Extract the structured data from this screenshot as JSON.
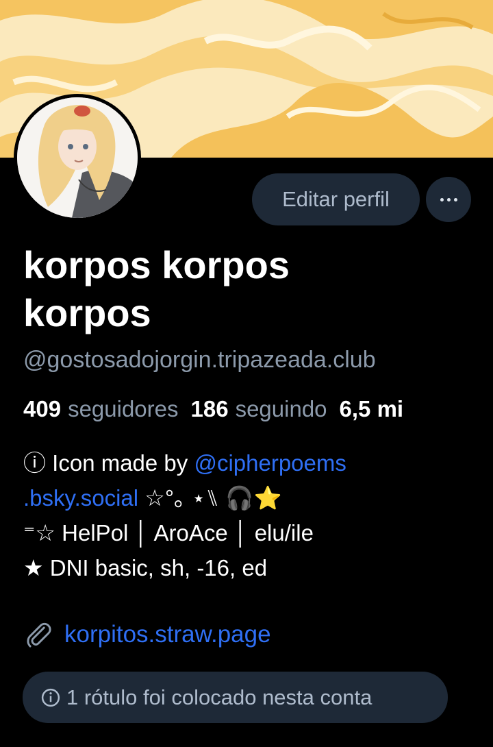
{
  "profile": {
    "display_name": "korpos korpos korpos",
    "handle": "@gostosadojorgin.tripazeada.club",
    "edit_button": "Editar perfil",
    "more_button_icon": "ellipsis-icon"
  },
  "stats": {
    "followers_count": "409",
    "followers_label": "seguidores",
    "following_count": "186",
    "following_label": "seguindo",
    "posts_count": "6,5 mi"
  },
  "bio": {
    "line1_prefix": "ⓘ Icon made by ",
    "line1_mention": "@cipherpoems",
    "line2_mention": ".bsky.social",
    "line2_suffix": " ☆°｡ ⋆⑊ 🎧⭐",
    "line3": "⁼☆ HelPol │ AroAce │ elu/ile",
    "line4": "★ DNI basic, sh, -16, ed"
  },
  "website": {
    "icon": "paperclip-icon",
    "url": "korpitos.straw.page"
  },
  "moderation": {
    "icon": "info-icon",
    "text": "1 rótulo foi colocado nesta conta"
  },
  "colors": {
    "background": "#000000",
    "pill": "#1e2937",
    "muted_text": "#8c9aab",
    "link": "#2f6ff4",
    "banner_base": "#fbe7b4",
    "banner_swirl": "#f6c35c"
  }
}
